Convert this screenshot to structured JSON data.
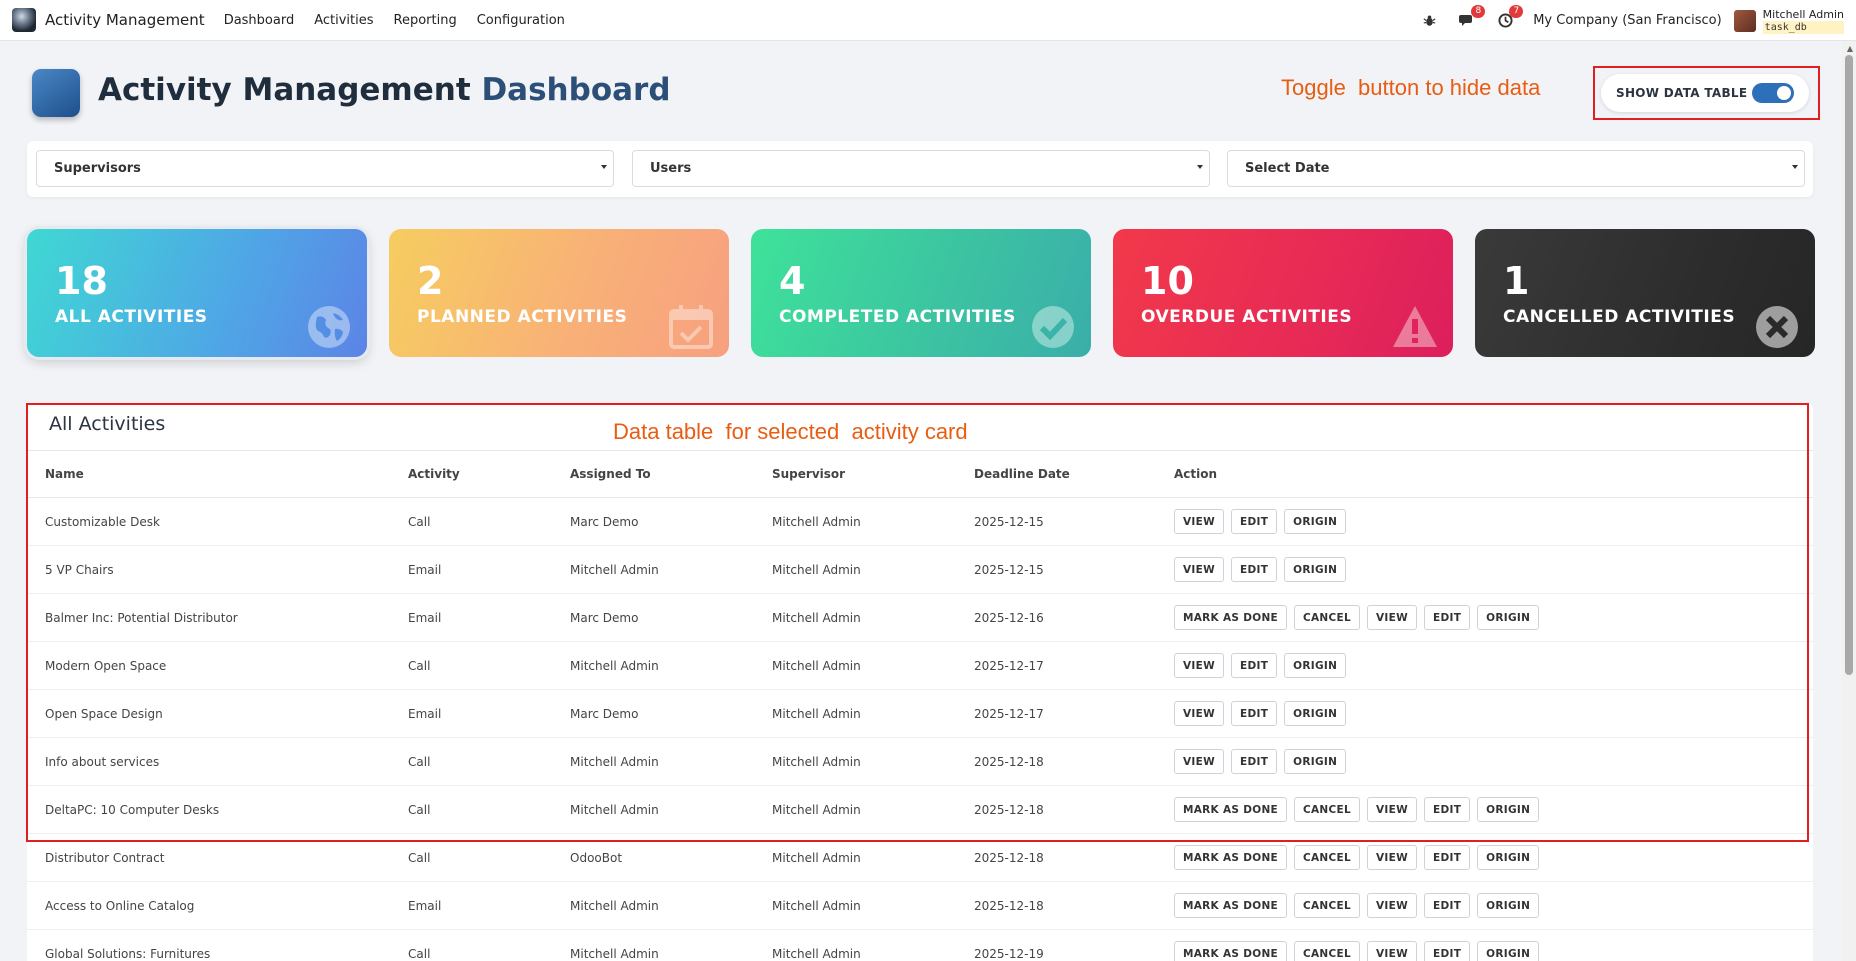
{
  "navbar": {
    "app_name": "Activity Management",
    "menu": [
      "Dashboard",
      "Activities",
      "Reporting",
      "Configuration"
    ],
    "messages_count": "8",
    "activities_count": "7",
    "company": "My Company (San Francisco)",
    "user_name": "Mitchell Admin",
    "user_db": "task_db"
  },
  "header": {
    "title_part1": "Activity Management",
    "title_part2": "Dashboard",
    "toggle_annotation": "Toggle  button to hide data",
    "toggle_label": "SHOW DATA TABLE",
    "toggle_on": true
  },
  "filters": {
    "supervisors": "Supervisors",
    "users": "Users",
    "date": "Select Date"
  },
  "cards": [
    {
      "count": "18",
      "label": "ALL ACTIVITIES",
      "icon": "globe-icon"
    },
    {
      "count": "2",
      "label": "PLANNED ACTIVITIES",
      "icon": "calendar-check-icon"
    },
    {
      "count": "4",
      "label": "COMPLETED ACTIVITIES",
      "icon": "check-circle-icon"
    },
    {
      "count": "10",
      "label": "OVERDUE ACTIVITIES",
      "icon": "warning-icon"
    },
    {
      "count": "1",
      "label": "CANCELLED ACTIVITIES",
      "icon": "times-circle-icon"
    }
  ],
  "table": {
    "title": "All Activities",
    "annotation": "Data table  for selected  activity card",
    "columns": [
      "Name",
      "Activity",
      "Assigned To",
      "Supervisor",
      "Deadline Date",
      "Action"
    ],
    "rows": [
      {
        "name": "Customizable Desk",
        "activity": "Call",
        "assigned": "Marc Demo",
        "supervisor": "Mitchell Admin",
        "deadline": "2025-12-15",
        "actions": [
          "VIEW",
          "EDIT",
          "ORIGIN"
        ]
      },
      {
        "name": "5 VP Chairs",
        "activity": "Email",
        "assigned": "Mitchell Admin",
        "supervisor": "Mitchell Admin",
        "deadline": "2025-12-15",
        "actions": [
          "VIEW",
          "EDIT",
          "ORIGIN"
        ]
      },
      {
        "name": "Balmer Inc: Potential Distributor",
        "activity": "Email",
        "assigned": "Marc Demo",
        "supervisor": "Mitchell Admin",
        "deadline": "2025-12-16",
        "actions": [
          "MARK AS DONE",
          "CANCEL",
          "VIEW",
          "EDIT",
          "ORIGIN"
        ]
      },
      {
        "name": "Modern Open Space",
        "activity": "Call",
        "assigned": "Mitchell Admin",
        "supervisor": "Mitchell Admin",
        "deadline": "2025-12-17",
        "actions": [
          "VIEW",
          "EDIT",
          "ORIGIN"
        ]
      },
      {
        "name": "Open Space Design",
        "activity": "Email",
        "assigned": "Marc Demo",
        "supervisor": "Mitchell Admin",
        "deadline": "2025-12-17",
        "actions": [
          "VIEW",
          "EDIT",
          "ORIGIN"
        ]
      },
      {
        "name": "Info about services",
        "activity": "Call",
        "assigned": "Mitchell Admin",
        "supervisor": "Mitchell Admin",
        "deadline": "2025-12-18",
        "actions": [
          "VIEW",
          "EDIT",
          "ORIGIN"
        ]
      },
      {
        "name": "DeltaPC: 10 Computer Desks",
        "activity": "Call",
        "assigned": "Mitchell Admin",
        "supervisor": "Mitchell Admin",
        "deadline": "2025-12-18",
        "actions": [
          "MARK AS DONE",
          "CANCEL",
          "VIEW",
          "EDIT",
          "ORIGIN"
        ]
      },
      {
        "name": "Distributor Contract",
        "activity": "Call",
        "assigned": "OdooBot",
        "supervisor": "Mitchell Admin",
        "deadline": "2025-12-18",
        "actions": [
          "MARK AS DONE",
          "CANCEL",
          "VIEW",
          "EDIT",
          "ORIGIN"
        ]
      },
      {
        "name": "Access to Online Catalog",
        "activity": "Email",
        "assigned": "Mitchell Admin",
        "supervisor": "Mitchell Admin",
        "deadline": "2025-12-18",
        "actions": [
          "MARK AS DONE",
          "CANCEL",
          "VIEW",
          "EDIT",
          "ORIGIN"
        ]
      },
      {
        "name": "Global Solutions: Furnitures",
        "activity": "Call",
        "assigned": "Mitchell Admin",
        "supervisor": "Mitchell Admin",
        "deadline": "2025-12-19",
        "actions": [
          "MARK AS DONE",
          "CANCEL",
          "VIEW",
          "EDIT",
          "ORIGIN"
        ]
      }
    ]
  },
  "colors": {
    "accent": "#2d6fb8",
    "annotation": "#e85d12",
    "highlight_frame": "#e02020"
  }
}
